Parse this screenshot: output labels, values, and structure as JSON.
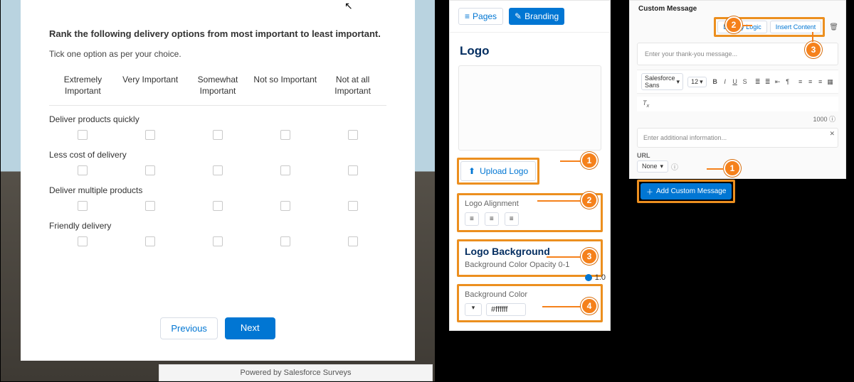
{
  "survey": {
    "question": "Rank the following delivery options from most important to least important.",
    "subtext": "Tick one option as per your choice.",
    "headers": [
      "Extremely Important",
      "Very Important",
      "Somewhat Important",
      "Not so Important",
      "Not at all Important"
    ],
    "rows": [
      "Deliver products quickly",
      "Less cost of delivery",
      "Deliver multiple products",
      "Friendly delivery"
    ],
    "prev": "Previous",
    "next": "Next",
    "footer": "Powered by Salesforce Surveys"
  },
  "branding": {
    "tabs": {
      "pages": "Pages",
      "branding": "Branding"
    },
    "logo_heading": "Logo",
    "upload": "Upload Logo",
    "alignment_label": "Logo Alignment",
    "bg_heading": "Logo Background",
    "opacity_label": "Background Color Opacity 0-1",
    "opacity_value": "1.0",
    "color_label": "Background Color",
    "color_value": "#ffffff",
    "callouts": [
      "1",
      "2",
      "3",
      "4"
    ]
  },
  "custom": {
    "title": "Custom Message",
    "display_logic": "Display Logic",
    "insert_content": "Insert Content",
    "placeholder": "Enter your thank-you message...",
    "font": "Salesforce Sans",
    "font_size": "12",
    "char_count": "1000",
    "additional_placeholder": "Enter additional information...",
    "url_label": "URL",
    "url_value": "None",
    "add_btn": "Add Custom Message",
    "callouts": [
      "1",
      "2",
      "3"
    ]
  }
}
